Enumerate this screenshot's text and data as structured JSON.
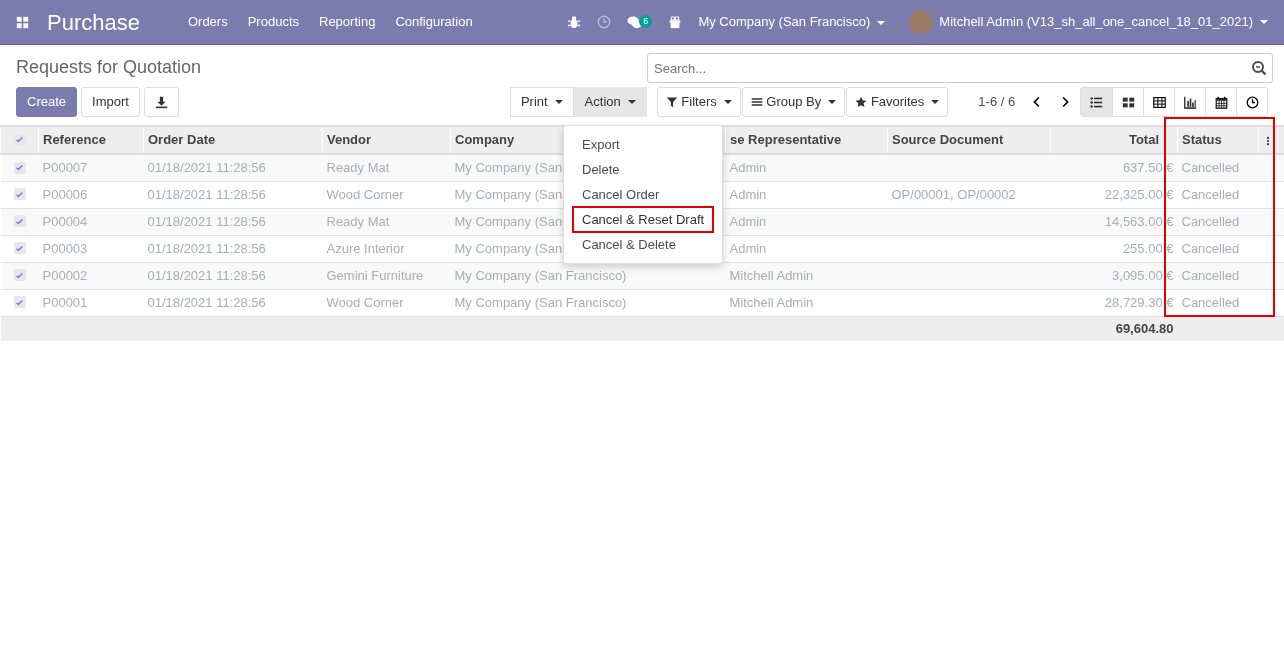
{
  "navbar": {
    "app": "Purchase",
    "menus": [
      "Orders",
      "Products",
      "Reporting",
      "Configuration"
    ],
    "message_count": "6",
    "company": "My Company (San Francisco)",
    "user": "Mitchell Admin (V13_sh_all_one_cancel_18_01_2021)"
  },
  "title": "Requests for Quotation",
  "buttons": {
    "create": "Create",
    "import": "Import"
  },
  "search": {
    "placeholder": "Search..."
  },
  "dropdowns": [
    {
      "label": "Print",
      "open": false
    },
    {
      "label": "Action",
      "open": true
    }
  ],
  "filters": [
    "Filters",
    "Group By",
    "Favorites"
  ],
  "pager": "1-6 / 6",
  "views": [
    {
      "kind": "list",
      "selected": true
    },
    {
      "kind": "kanban",
      "selected": false
    },
    {
      "kind": "pivot",
      "selected": false
    },
    {
      "kind": "graph",
      "selected": false
    },
    {
      "kind": "calendar",
      "selected": false
    },
    {
      "kind": "activity",
      "selected": false
    }
  ],
  "action_menu": [
    {
      "label": "Export",
      "highlighted": false
    },
    {
      "label": "Delete",
      "highlighted": false
    },
    {
      "label": "Cancel Order",
      "highlighted": false
    },
    {
      "label": "Cancel & Reset Draft",
      "highlighted": true
    },
    {
      "label": "Cancel & Delete",
      "highlighted": false
    }
  ],
  "table": {
    "all_selected": true,
    "status_highlighted": true,
    "columns": [
      "Reference",
      "Order Date",
      "Vendor",
      "Company",
      "se Representative",
      "Source Document",
      "Total",
      "Status"
    ],
    "rows": [
      {
        "selected": true,
        "muted": true,
        "cells": [
          "P00007",
          "01/18/2021 11:28:56",
          "Ready Mat",
          "My Company (San",
          "Admin",
          "",
          "637.50 €",
          "Cancelled"
        ]
      },
      {
        "selected": true,
        "muted": true,
        "cells": [
          "P00006",
          "01/18/2021 11:28:56",
          "Wood Corner",
          "My Company (San",
          "Admin",
          "OP/00001, OP/00002",
          "22,325.00 €",
          "Cancelled"
        ]
      },
      {
        "selected": true,
        "muted": true,
        "cells": [
          "P00004",
          "01/18/2021 11:28:56",
          "Ready Mat",
          "My Company (San",
          "Admin",
          "",
          "14,563.00 €",
          "Cancelled"
        ]
      },
      {
        "selected": true,
        "muted": true,
        "cells": [
          "P00003",
          "01/18/2021 11:28:56",
          "Azure Interior",
          "My Company (San",
          "Admin",
          "",
          "255.00 €",
          "Cancelled"
        ]
      },
      {
        "selected": true,
        "muted": true,
        "cells": [
          "P00002",
          "01/18/2021 11:28:56",
          "Gemini Furniture",
          "My Company (San Francisco)",
          "Mitchell Admin",
          "",
          "3,095.00 €",
          "Cancelled"
        ]
      },
      {
        "selected": true,
        "muted": true,
        "cells": [
          "P00001",
          "01/18/2021 11:28:56",
          "Wood Corner",
          "My Company (San Francisco)",
          "Mitchell Admin",
          "",
          "28,729.30 €",
          "Cancelled"
        ]
      }
    ],
    "total": "69,604.80"
  }
}
